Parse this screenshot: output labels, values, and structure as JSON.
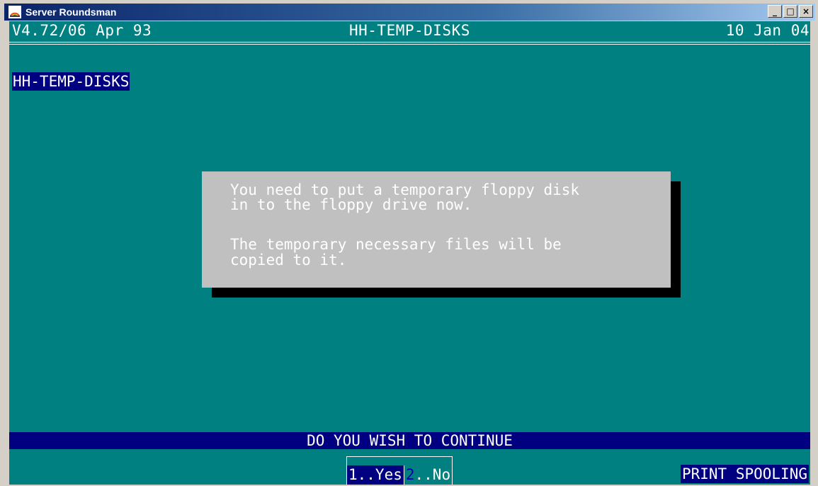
{
  "window": {
    "title": "Server Roundsman",
    "buttons": {
      "minimize": "_",
      "maximize": "□",
      "close": "×"
    }
  },
  "header": {
    "version": "V4.72/06 Apr 93",
    "program": "HH-TEMP-DISKS",
    "date": "10 Jan 04"
  },
  "program_label": "HH-TEMP-DISKS",
  "dialog": {
    "lines": [
      "You need to put a temporary floppy disk",
      "in to the floppy drive now.",
      "The temporary necessary files will be",
      "copied to it."
    ]
  },
  "prompt": "DO YOU WISH TO CONTINUE",
  "options": {
    "yes": "1..Yes",
    "no_num": "2",
    "no_label": "..No"
  },
  "status": "PRINT SPOOLING",
  "colors": {
    "console_bg": "#008080",
    "highlight_bg": "#000080",
    "dialog_bg": "#c0c0c0"
  }
}
